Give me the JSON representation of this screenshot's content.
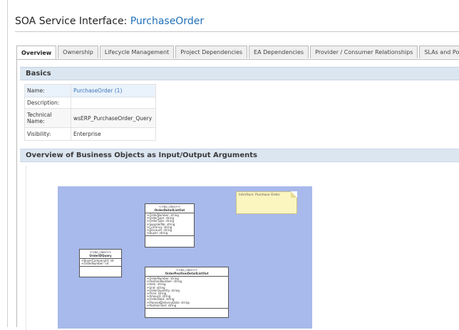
{
  "page": {
    "title_prefix": "SOA Service Interface:",
    "title_object": "PurchaseOrder"
  },
  "tabs": [
    {
      "label": "Overview",
      "active": true
    },
    {
      "label": "Ownership"
    },
    {
      "label": "Lifecycle Management"
    },
    {
      "label": "Project Dependencies"
    },
    {
      "label": "EA Dependencies"
    },
    {
      "label": "Provider / Consumer Relationships"
    },
    {
      "label": "SLAs and Policies"
    }
  ],
  "basics": {
    "header": "Basics",
    "rows": [
      {
        "label": "Name:",
        "value": "PurchaseOrder (1)"
      },
      {
        "label": "Description:",
        "value": ""
      },
      {
        "label": "Technical Name:",
        "value": "wsERP_PurchaseOrder_Query"
      },
      {
        "label": "Visibility:",
        "value": "Enterprise"
      }
    ]
  },
  "overview": {
    "header": "Overview of Business Objects as Input/Output Arguments"
  },
  "diagram": {
    "note_text": "Interface: Purchase Order",
    "classes": [
      {
        "stereotype": "<<bo_class>>",
        "name": "OrderIDQuery",
        "attributes": [
          "+BuyerCompanyId: int",
          "+OrderNumber: int"
        ]
      },
      {
        "stereotype": "<<bo_class>>",
        "name": "OrderDetailListOut",
        "attributes": [
          "+OrderNumber: string",
          "+OrderType: string",
          "+OrderType: string",
          "+SupplierNo: string",
          "+Currency: string",
          "+Discount: string",
          "+Buyer: string"
        ]
      },
      {
        "stereotype": "<<bo_class>>",
        "name": "OrderPositionDetailListOut",
        "attributes": [
          "+OrderNumber: string",
          "+PositionNumber: string",
          "+Item: string",
          "+Unit: string",
          "+OrderQuantity: string",
          "+Price: string",
          "+Amount: string",
          "+OrderDate: string",
          "+PlannedDeliveryDate: string",
          "+PositionText: string"
        ]
      }
    ]
  }
}
